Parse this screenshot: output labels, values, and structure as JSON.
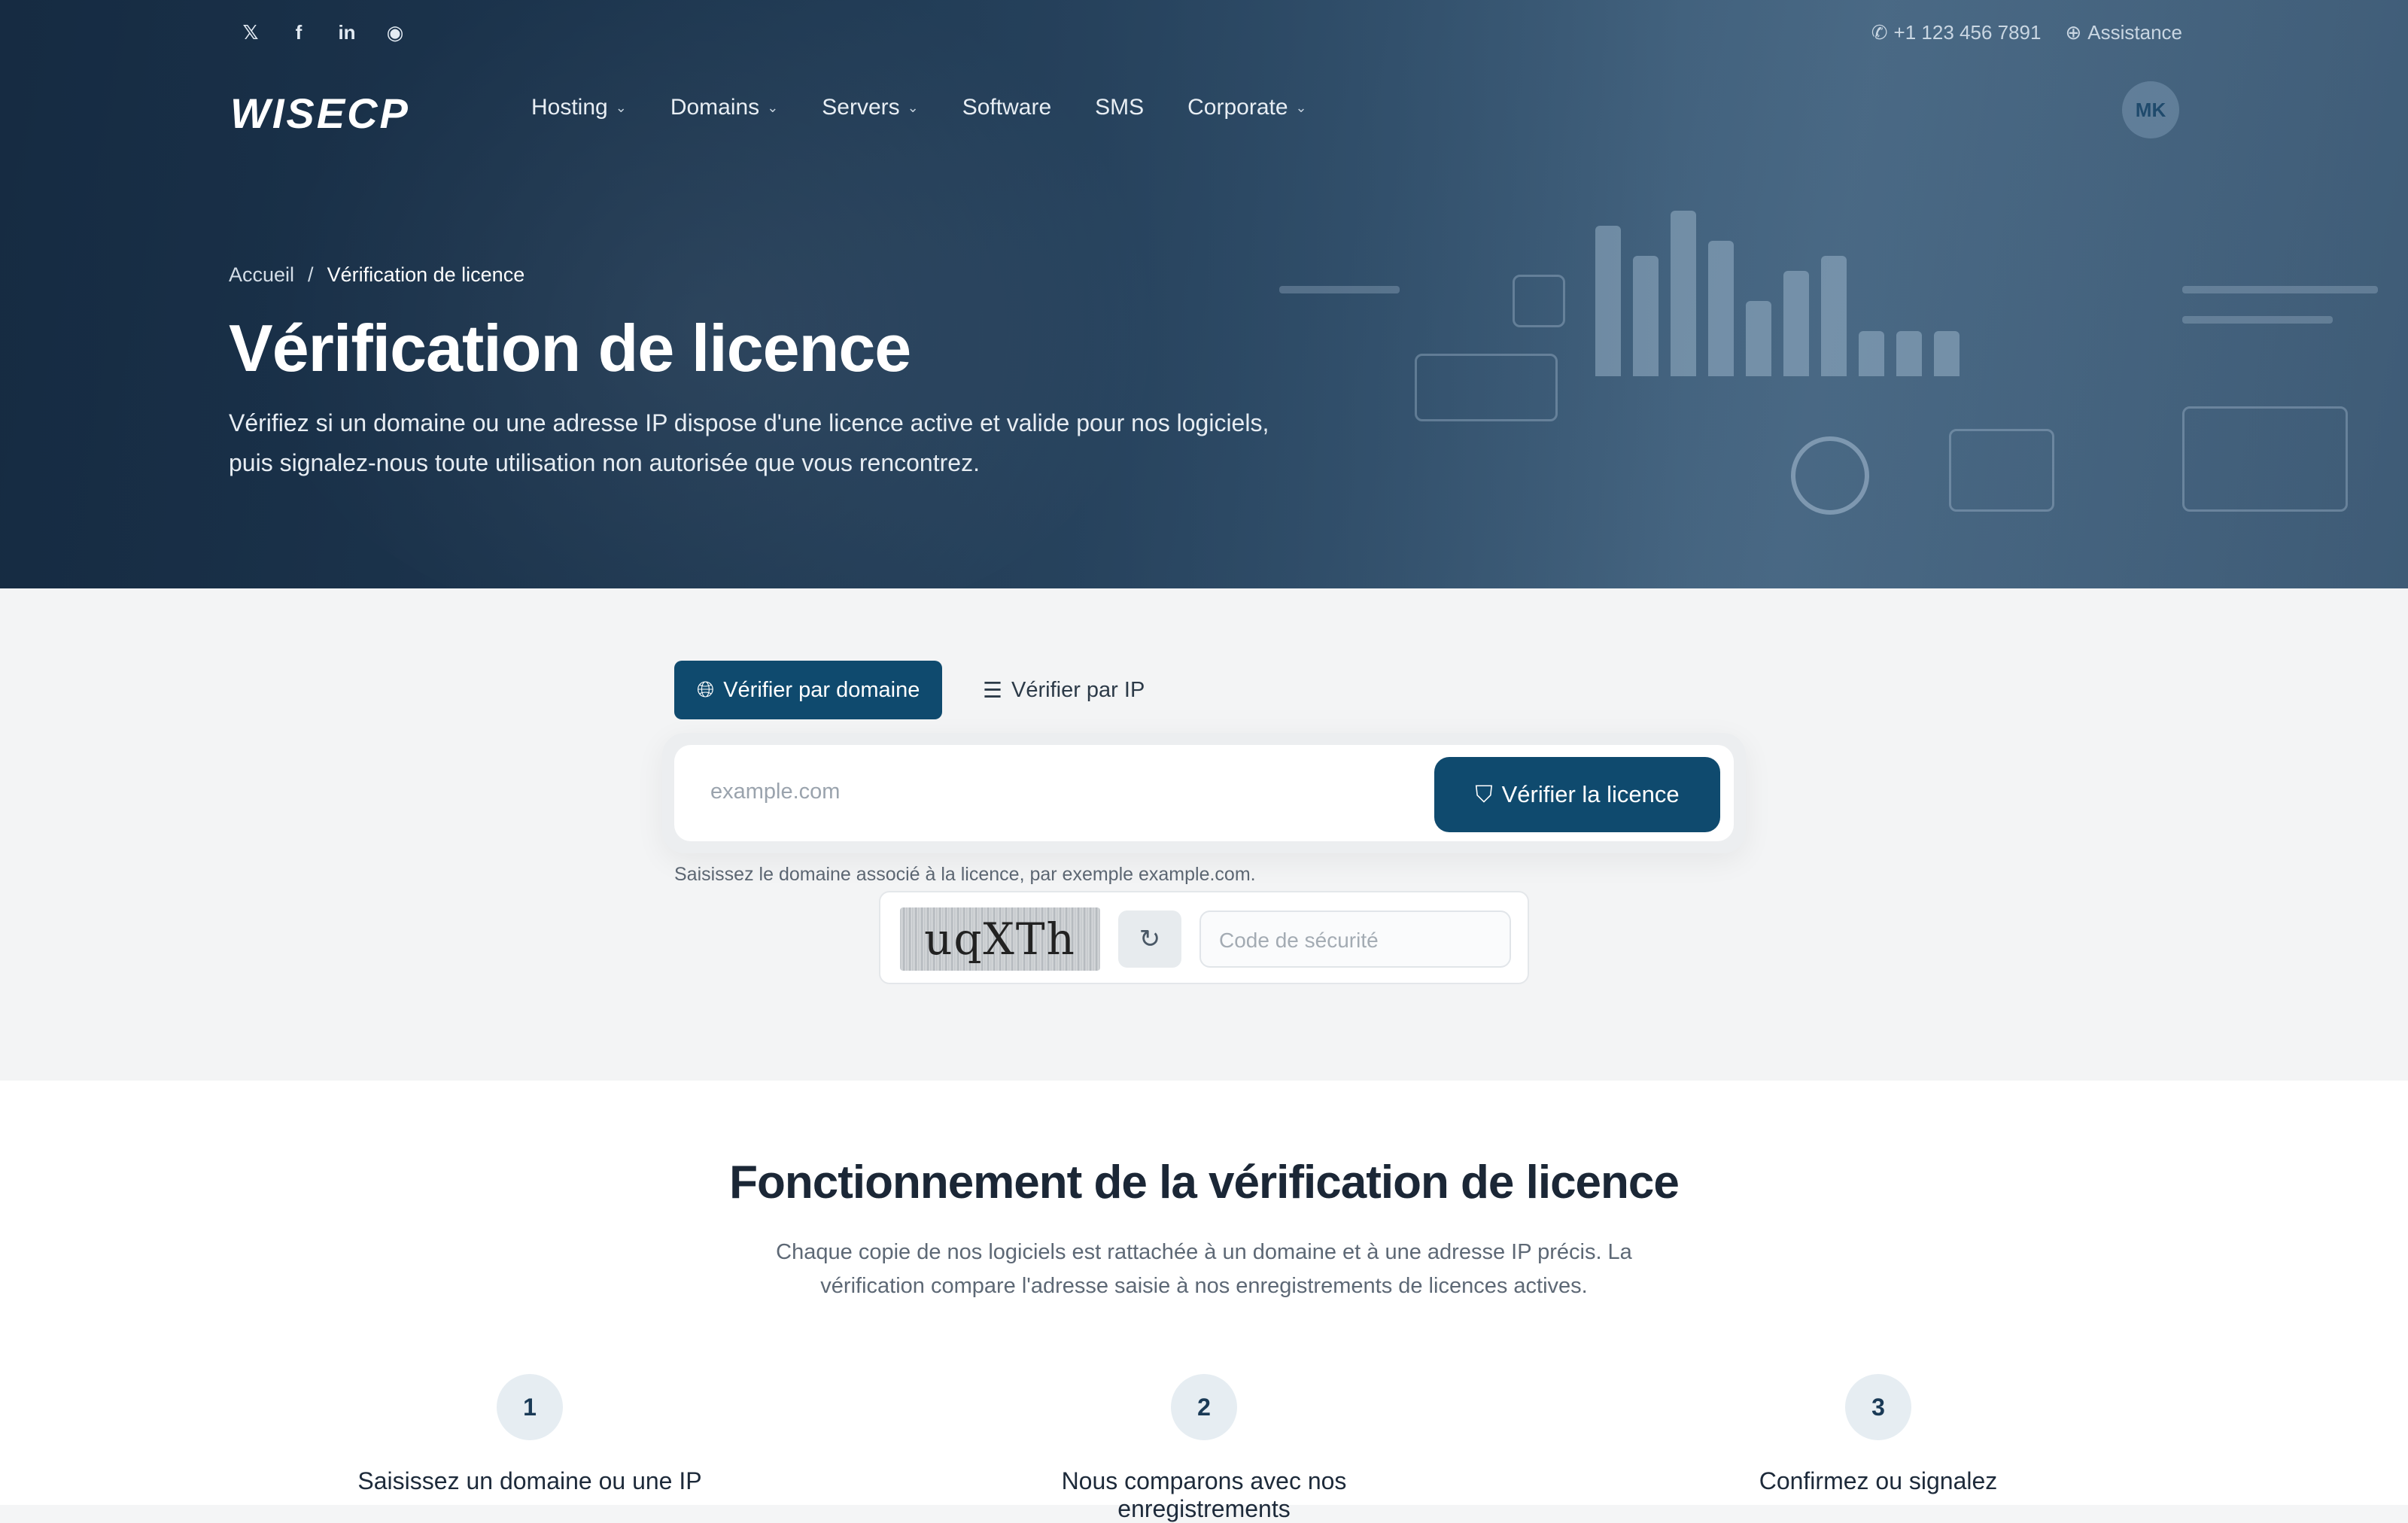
{
  "social": [
    {
      "icon": "x-icon",
      "glyph": "𝕏"
    },
    {
      "icon": "facebook-icon",
      "glyph": "f"
    },
    {
      "icon": "linkedin-icon",
      "glyph": "in"
    },
    {
      "icon": "discord-icon",
      "glyph": "◉"
    }
  ],
  "topbar": {
    "phone": "+1 123 456 7891",
    "support": "Assistance"
  },
  "logo": "WISECP",
  "nav": [
    {
      "label": "Hosting",
      "dropdown": true
    },
    {
      "label": "Domains",
      "dropdown": true
    },
    {
      "label": "Servers",
      "dropdown": true
    },
    {
      "label": "Software",
      "dropdown": false
    },
    {
      "label": "SMS",
      "dropdown": false
    },
    {
      "label": "Corporate",
      "dropdown": true
    }
  ],
  "avatar_initials": "MK",
  "breadcrumb": {
    "home": "Accueil",
    "separator": "/",
    "current": "Vérification de licence"
  },
  "hero": {
    "title": "Vérification de licence",
    "subtitle": "Vérifiez si un domaine ou une adresse IP dispose d'une licence active et valide pour nos logiciels, puis signalez-nous toute utilisation non autorisée que vous rencontrez."
  },
  "verify": {
    "tab_domain": "Vérifier par domaine",
    "tab_ip": "Vérifier par IP",
    "input_placeholder": "example.com",
    "button": "Vérifier la licence",
    "hint": "Saisissez le domaine associé à la licence, par exemple example.com.",
    "captcha_text": "uqXTh",
    "security_placeholder": "Code de sécurité"
  },
  "how": {
    "title": "Fonctionnement de la vérification de licence",
    "description": "Chaque copie de nos logiciels est rattachée à un domaine et à une adresse IP précis. La vérification compare l'adresse saisie à nos enregistrements de licences actives.",
    "steps": [
      {
        "num": "1",
        "title": "Saisissez un domaine ou une IP"
      },
      {
        "num": "2",
        "title": "Nous comparons avec nos enregistrements"
      },
      {
        "num": "3",
        "title": "Confirmez ou signalez"
      }
    ]
  },
  "colors": {
    "primary": "#0f4a6e",
    "hero_dark": "#1b3550"
  }
}
